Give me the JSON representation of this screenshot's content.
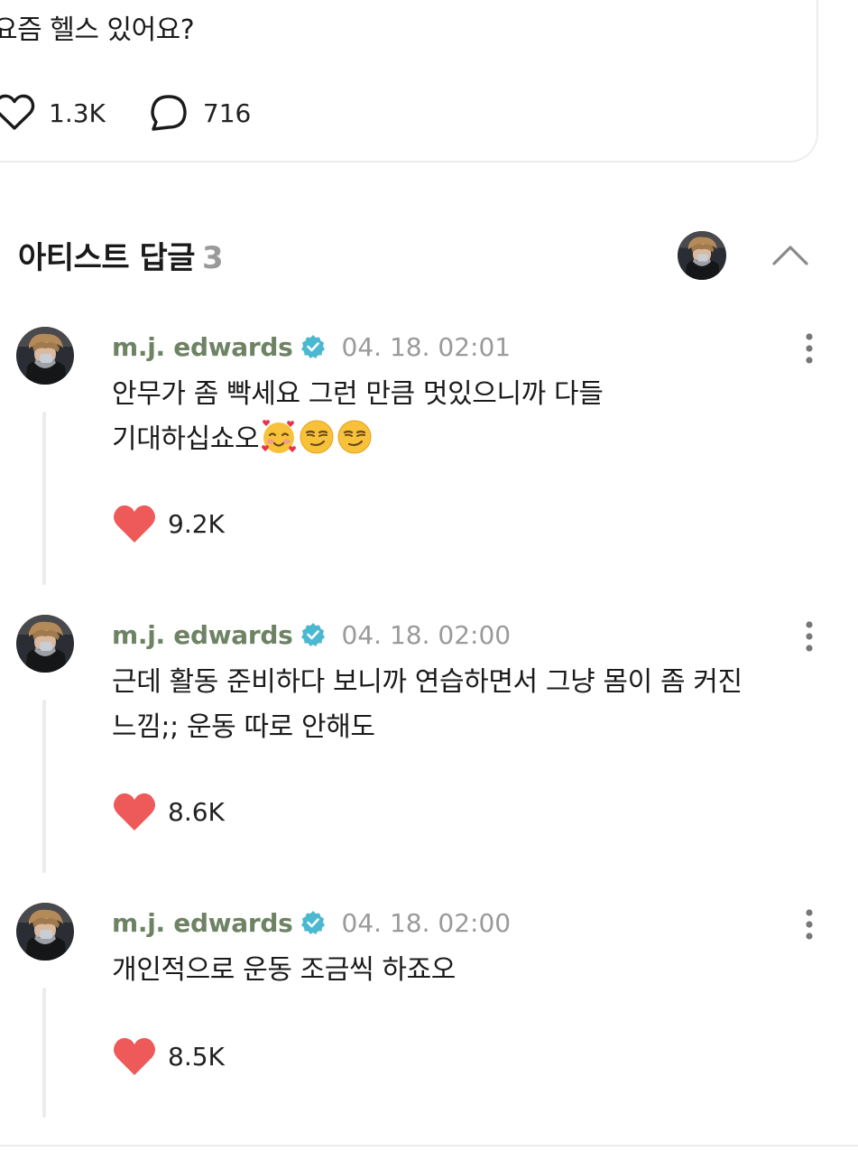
{
  "post": {
    "text": "요즘 헬스 있어요?",
    "likes": "1.3K",
    "comments": "716"
  },
  "section": {
    "title": "아티스트 답글",
    "count": "3"
  },
  "replies": [
    {
      "author": "m.j. edwards",
      "time": "04. 18. 02:01",
      "text_line1": "안무가 좀 빡세요 그런 만큼 멋있으니까 다들",
      "text_line2": "기대하십쇼오",
      "emojis": [
        "smiling-face-with-hearts",
        "smirking-face",
        "smirking-face"
      ],
      "likes": "9.2K"
    },
    {
      "author": "m.j. edwards",
      "time": "04. 18. 02:00",
      "text_line1": "근데 활동 준비하다 보니까 연습하면서 그냥 몸이 좀 커진",
      "text_line2": "느낌;; 운동 따로 안해도",
      "likes": "8.6K"
    },
    {
      "author": "m.j. edwards",
      "time": "04. 18. 02:00",
      "text_line1": "개인적으로 운동 조금씩 하죠오",
      "likes": "8.5K"
    }
  ],
  "colors": {
    "author": "#6e8264",
    "verified": "#4bb8d1",
    "heart": "#ee5a5a",
    "muted": "#9a9a9a"
  }
}
